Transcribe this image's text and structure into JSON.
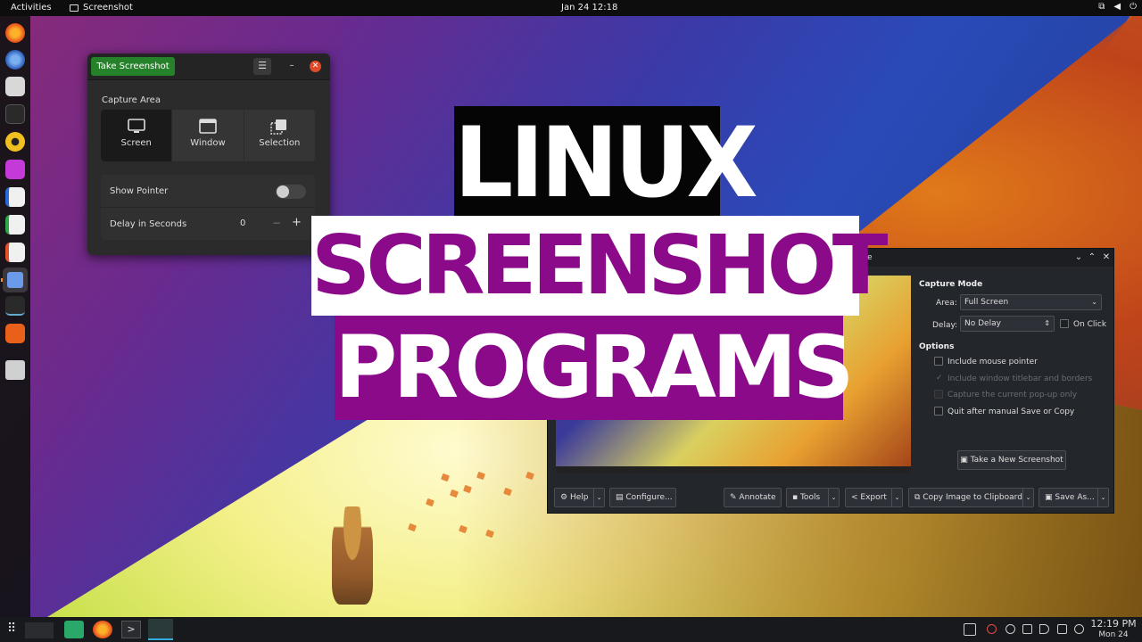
{
  "topbar": {
    "activities": "Activities",
    "app_name": "Screenshot",
    "clock": "Jan 24  12:18"
  },
  "gnome_screenshot": {
    "take_button": "Take Screenshot",
    "menu_glyph": "☰",
    "minimize_glyph": "–",
    "close_glyph": "✕",
    "capture_area_label": "Capture Area",
    "modes": [
      {
        "label": "Screen",
        "selected": true
      },
      {
        "label": "Window",
        "selected": false
      },
      {
        "label": "Selection",
        "selected": false
      }
    ],
    "show_pointer_label": "Show Pointer",
    "show_pointer_on": false,
    "delay_label": "Delay in Seconds",
    "delay_value": "0",
    "minus_glyph": "−",
    "plus_glyph": "+"
  },
  "title_overlay": {
    "line1": "LINUX",
    "line2": "SCREENSHOT",
    "line3": "PROGRAMS",
    "colors": {
      "purple": "#8a0a8a",
      "black": "#050505",
      "white": "#ffffff"
    }
  },
  "spectacle": {
    "title_fragment": "acle",
    "capture_mode_label": "Capture Mode",
    "area_label": "Area:",
    "area_value": "Full Screen",
    "delay_label": "Delay:",
    "delay_value": "No Delay",
    "on_click_label": "On Click",
    "options_label": "Options",
    "options": [
      {
        "label": "Include mouse pointer",
        "checked": false,
        "enabled": true
      },
      {
        "label": "Include window titlebar and borders",
        "checked": true,
        "enabled": false
      },
      {
        "label": "Capture the current pop-up only",
        "checked": false,
        "enabled": false
      },
      {
        "label": "Quit after manual Save or Copy",
        "checked": false,
        "enabled": true
      }
    ],
    "new_screenshot_button": "Take a New Screenshot",
    "buttons": {
      "help": "Help",
      "configure": "Configure...",
      "annotate": "Annotate",
      "tools": "Tools",
      "export": "Export",
      "copy_clipboard": "Copy Image to Clipboard",
      "save_as": "Save As..."
    }
  },
  "panel": {
    "time": "12:19 PM",
    "date": "Mon 24"
  }
}
